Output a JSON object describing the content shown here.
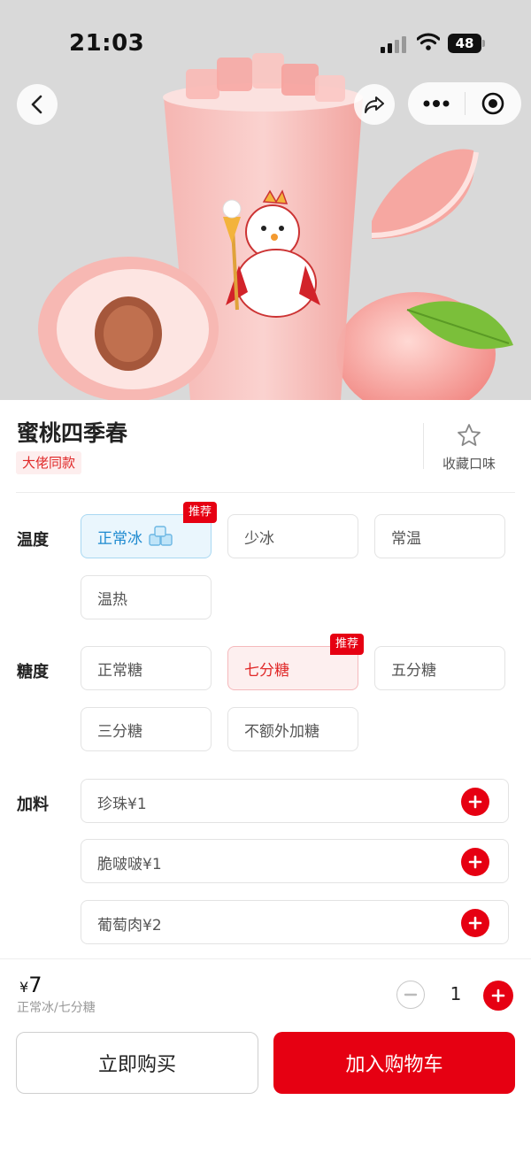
{
  "status_bar": {
    "time": "21:03",
    "battery": "48"
  },
  "product": {
    "name": "蜜桃四季春",
    "tag": "大佬同款",
    "favorite_label": "收藏口味"
  },
  "badge_recommend": "推荐",
  "temperature": {
    "label": "温度",
    "options": [
      "正常冰",
      "少冰",
      "常温",
      "温热"
    ],
    "selected": "正常冰"
  },
  "sugar": {
    "label": "糖度",
    "options": [
      "正常糖",
      "七分糖",
      "五分糖",
      "三分糖",
      "不额外加糖"
    ],
    "selected": "七分糖"
  },
  "toppings": {
    "label": "加料",
    "items": [
      "珍珠¥1",
      "脆啵啵¥1",
      "葡萄肉¥2"
    ]
  },
  "footer": {
    "currency": "¥",
    "price": "7",
    "summary": "正常冰/七分糖",
    "quantity": "1",
    "buy_now": "立即购买",
    "add_to_cart": "加入购物车"
  },
  "colors": {
    "accent": "#e60012",
    "selected_blue": "#1e8ad0",
    "hero_bg": "#d9d9d9"
  }
}
